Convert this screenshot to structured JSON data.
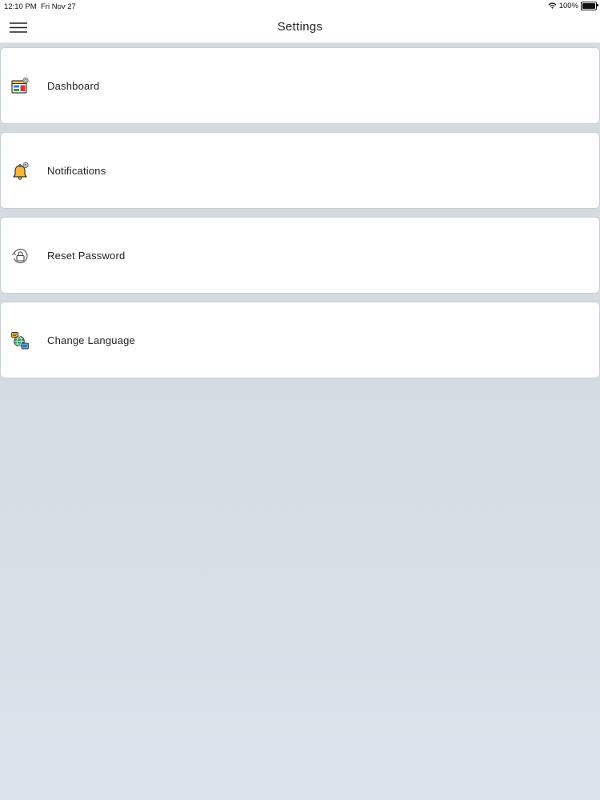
{
  "status_bar": {
    "time": "12:10 PM",
    "date": "Fri Nov 27",
    "battery": "100%"
  },
  "header": {
    "title": "Settings",
    "menu_icon": "hamburger-menu-icon"
  },
  "settings": {
    "items": [
      {
        "label": "Dashboard",
        "icon": "dashboard-icon"
      },
      {
        "label": "Notifications",
        "icon": "notification-bell-icon"
      },
      {
        "label": "Reset Password",
        "icon": "reset-password-lock-icon"
      },
      {
        "label": "Change Language",
        "icon": "language-globe-icon"
      }
    ]
  },
  "colors": {
    "background": "#d5dbe2",
    "card": "#ffffff",
    "card_border": "#c9d0d3",
    "text": "#222222"
  }
}
